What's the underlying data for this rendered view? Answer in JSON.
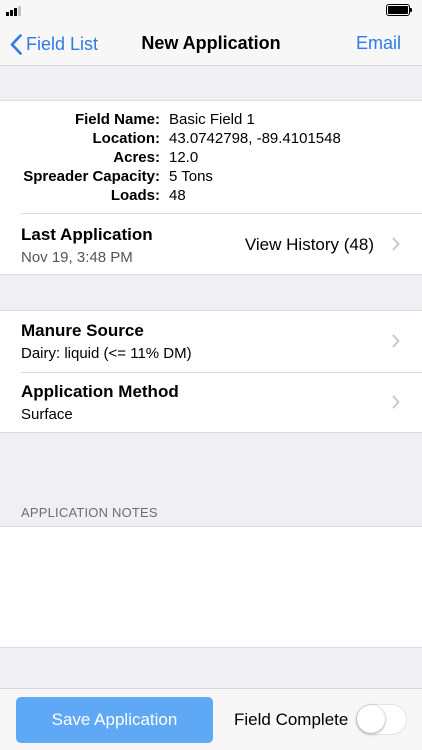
{
  "status_bar": {
    "signal_icon": "cellular-signal-icon",
    "battery_icon": "battery-icon"
  },
  "nav": {
    "back_label": "Field List",
    "back_icon": "chevron-left-icon",
    "title": "New Application",
    "right_label": "Email"
  },
  "field_info": {
    "rows": [
      {
        "label": "Field Name:",
        "value": "Basic Field 1"
      },
      {
        "label": "Location:",
        "value": "43.0742798, -89.4101548"
      },
      {
        "label": "Acres:",
        "value": "12.0"
      },
      {
        "label": "Spreader Capacity:",
        "value": "5 Tons"
      },
      {
        "label": "Loads:",
        "value": "48"
      }
    ]
  },
  "last_application": {
    "title": "Last Application",
    "date": "Nov 19, 3:48 PM",
    "history_label": "View History (48)"
  },
  "manure_source": {
    "title": "Manure Source",
    "value": "Dairy: liquid (<= 11% DM)"
  },
  "application_method": {
    "title": "Application Method",
    "value": "Surface"
  },
  "notes": {
    "header": "APPLICATION NOTES",
    "value": ""
  },
  "bottom": {
    "save_label": "Save Application",
    "toggle_label": "Field Complete",
    "toggle_on": false
  },
  "colors": {
    "accent": "#2f7ae5",
    "button": "#5ea8f6",
    "background": "#efeff4"
  }
}
